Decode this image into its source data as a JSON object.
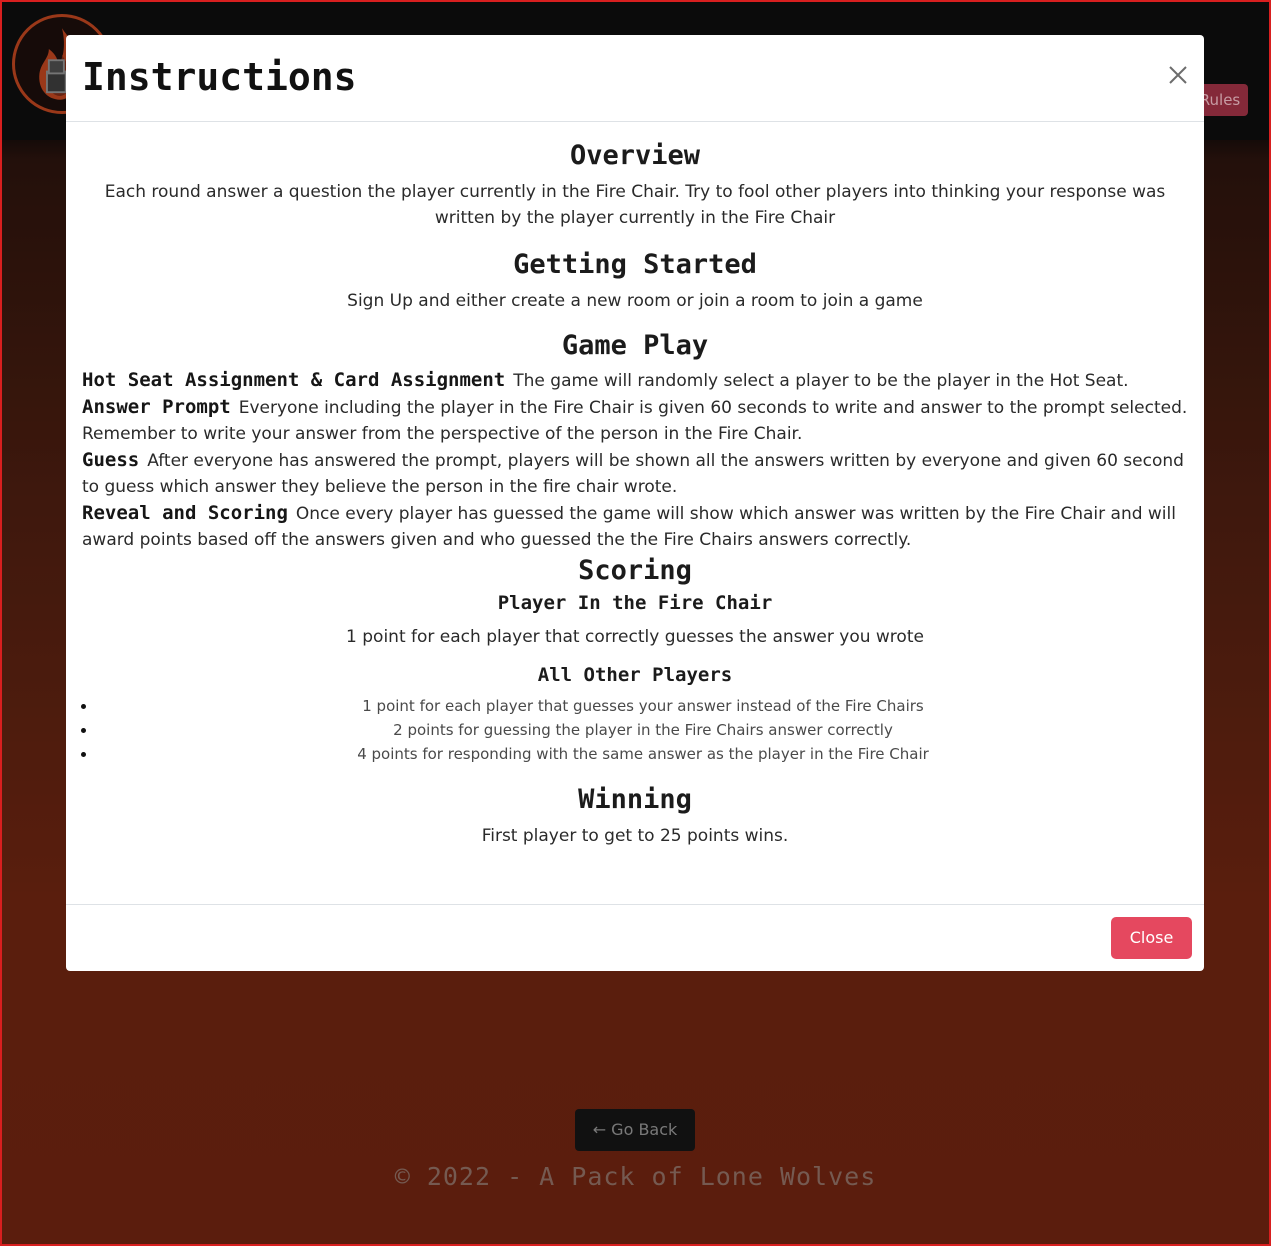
{
  "navbar": {
    "rules_label": "Rules"
  },
  "modal": {
    "title": "Instructions",
    "overview": {
      "heading": "Overview",
      "text": "Each round answer a question the player currently in the Fire Chair. Try to fool other players into thinking your response was written by the player currently in the Fire Chair"
    },
    "getting_started": {
      "heading": "Getting Started",
      "text": "Sign Up and either create a new room or join a room to join a game"
    },
    "game_play": {
      "heading": "Game Play",
      "items": [
        {
          "term": "Hot Seat Assignment & Card Assignment",
          "text": "The game will randomly select a player to be the player in the Hot Seat."
        },
        {
          "term": "Answer Prompt",
          "text": "Everyone including the player in the Fire Chair is given 60 seconds to write and answer to the prompt selected. Remember to write your answer from the perspective of the person in the Fire Chair."
        },
        {
          "term": "Guess",
          "text": "After everyone has answered the prompt, players will be shown all the answers written by everyone and given 60 second to guess which answer they believe the person in the fire chair wrote."
        },
        {
          "term": "Reveal and Scoring",
          "text": "Once every player has guessed the game will show which answer was written by the Fire Chair and will award points based off the answers given and who guessed the the Fire Chairs answers correctly."
        }
      ]
    },
    "scoring": {
      "heading": "Scoring",
      "fire_chair_heading": "Player In the Fire Chair",
      "fire_chair_text": "1 point for each player that correctly guesses the answer you wrote",
      "others_heading": "All Other Players",
      "others_items": [
        "1 point for each player that guesses your answer instead of the Fire Chairs",
        "2 points for guessing the player in the Fire Chairs answer correctly",
        "4 points for responding with the same answer as the player in the Fire Chair"
      ]
    },
    "winning": {
      "heading": "Winning",
      "text": "First player to get to 25 points wins."
    },
    "close_label": "Close"
  },
  "page": {
    "go_back_label": "← Go Back",
    "footer": "© 2022 - A Pack of Lone Wolves"
  },
  "colors": {
    "accent": "#e5485f",
    "brand": "#b5421e"
  }
}
